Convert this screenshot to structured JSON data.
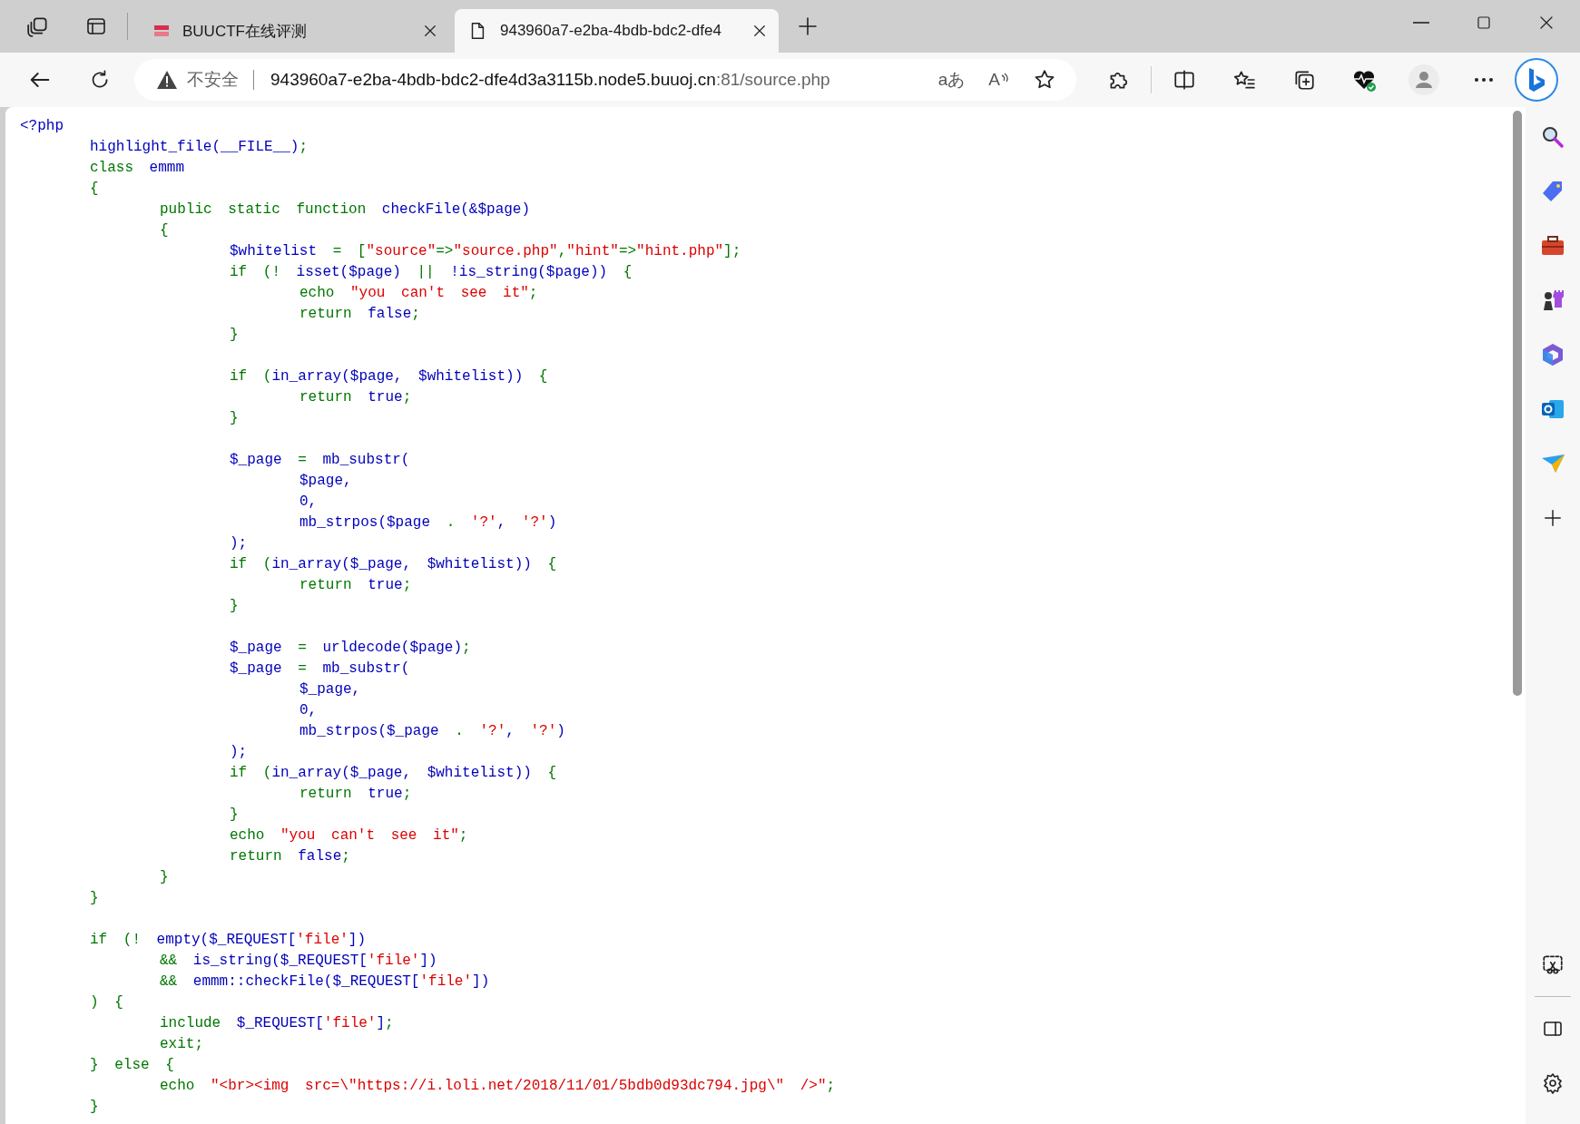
{
  "tabs": [
    {
      "title": "BUUCTF在线评测",
      "selected": false,
      "kind": "site"
    },
    {
      "title": "943960a7-e2ba-4bdb-bdc2-dfe4",
      "selected": true,
      "kind": "page"
    }
  ],
  "address_bar": {
    "security_label": "不安全",
    "url_host": "943960a7-e2ba-4bdb-bdc2-dfe4d3a3115b.node5.buuoj.cn",
    "url_path": ":81/source.php",
    "translate_glyph": "aあ",
    "read_aloud_glyph": "A"
  },
  "code": {
    "lines": [
      {
        "tokens": [
          {
            "kind": "id",
            "text": "<?php"
          }
        ]
      },
      {
        "tokens": [
          {
            "kind": "id",
            "text": "\thighlight_file(__FILE__)"
          },
          {
            "kind": "kw",
            "text": ";"
          }
        ]
      },
      {
        "tokens": [
          {
            "kind": "kw",
            "text": "\tclass "
          },
          {
            "kind": "id",
            "text": "emmm"
          }
        ]
      },
      {
        "tokens": [
          {
            "kind": "kw",
            "text": "\t{"
          }
        ]
      },
      {
        "tokens": [
          {
            "kind": "kw",
            "text": "\t\tpublic static function "
          },
          {
            "kind": "id",
            "text": "checkFile(&$page)"
          }
        ]
      },
      {
        "tokens": [
          {
            "kind": "kw",
            "text": "\t\t{"
          }
        ]
      },
      {
        "tokens": [
          {
            "kind": "id",
            "text": "\t\t\t$whitelist "
          },
          {
            "kind": "kw",
            "text": "= ["
          },
          {
            "kind": "str",
            "text": "\"source\""
          },
          {
            "kind": "kw",
            "text": "=>"
          },
          {
            "kind": "str",
            "text": "\"source.php\""
          },
          {
            "kind": "kw",
            "text": ","
          },
          {
            "kind": "str",
            "text": "\"hint\""
          },
          {
            "kind": "kw",
            "text": "=>"
          },
          {
            "kind": "str",
            "text": "\"hint.php\""
          },
          {
            "kind": "kw",
            "text": "];"
          }
        ]
      },
      {
        "tokens": [
          {
            "kind": "kw",
            "text": "\t\t\tif (! "
          },
          {
            "kind": "id",
            "text": "isset($page) "
          },
          {
            "kind": "kw",
            "text": "|| "
          },
          {
            "kind": "id",
            "text": "!is_string($page)) "
          },
          {
            "kind": "kw",
            "text": "{"
          }
        ]
      },
      {
        "tokens": [
          {
            "kind": "kw",
            "text": "\t\t\t\techo "
          },
          {
            "kind": "str",
            "text": "\"you can't see it\""
          },
          {
            "kind": "kw",
            "text": ";"
          }
        ]
      },
      {
        "tokens": [
          {
            "kind": "kw",
            "text": "\t\t\t\treturn "
          },
          {
            "kind": "id",
            "text": "false"
          },
          {
            "kind": "kw",
            "text": ";"
          }
        ]
      },
      {
        "tokens": [
          {
            "kind": "kw",
            "text": "\t\t\t}"
          }
        ]
      },
      {
        "blank_before": true,
        "tokens": [
          {
            "kind": "kw",
            "text": "\t\t\tif ("
          },
          {
            "kind": "id",
            "text": "in_array($page, $whitelist)) "
          },
          {
            "kind": "kw",
            "text": "{"
          }
        ]
      },
      {
        "tokens": [
          {
            "kind": "kw",
            "text": "\t\t\t\treturn "
          },
          {
            "kind": "id",
            "text": "true"
          },
          {
            "kind": "kw",
            "text": ";"
          }
        ]
      },
      {
        "tokens": [
          {
            "kind": "kw",
            "text": "\t\t\t}"
          }
        ]
      },
      {
        "blank_before": true,
        "tokens": [
          {
            "kind": "id",
            "text": "\t\t\t$_page "
          },
          {
            "kind": "kw",
            "text": "= "
          },
          {
            "kind": "id",
            "text": "mb_substr("
          }
        ]
      },
      {
        "tokens": [
          {
            "kind": "id",
            "text": "\t\t\t\t$page,"
          }
        ]
      },
      {
        "tokens": [
          {
            "kind": "id",
            "text": "\t\t\t\t0,"
          }
        ]
      },
      {
        "tokens": [
          {
            "kind": "id",
            "text": "\t\t\t\tmb_strpos($page "
          },
          {
            "kind": "kw",
            "text": ". "
          },
          {
            "kind": "str",
            "text": "'?'"
          },
          {
            "kind": "id",
            "text": ", "
          },
          {
            "kind": "str",
            "text": "'?'"
          },
          {
            "kind": "id",
            "text": ")"
          }
        ]
      },
      {
        "tokens": [
          {
            "kind": "id",
            "text": "\t\t\t);"
          }
        ]
      },
      {
        "tokens": [
          {
            "kind": "kw",
            "text": "\t\t\tif ("
          },
          {
            "kind": "id",
            "text": "in_array($_page, $whitelist)) "
          },
          {
            "kind": "kw",
            "text": "{"
          }
        ]
      },
      {
        "tokens": [
          {
            "kind": "kw",
            "text": "\t\t\t\treturn "
          },
          {
            "kind": "id",
            "text": "true"
          },
          {
            "kind": "kw",
            "text": ";"
          }
        ]
      },
      {
        "tokens": [
          {
            "kind": "kw",
            "text": "\t\t\t}"
          }
        ]
      },
      {
        "blank_before": true,
        "tokens": [
          {
            "kind": "id",
            "text": "\t\t\t$_page "
          },
          {
            "kind": "kw",
            "text": "= "
          },
          {
            "kind": "id",
            "text": "urldecode($page)"
          },
          {
            "kind": "kw",
            "text": ";"
          }
        ]
      },
      {
        "tokens": [
          {
            "kind": "id",
            "text": "\t\t\t$_page "
          },
          {
            "kind": "kw",
            "text": "= "
          },
          {
            "kind": "id",
            "text": "mb_substr("
          }
        ]
      },
      {
        "tokens": [
          {
            "kind": "id",
            "text": "\t\t\t\t$_page,"
          }
        ]
      },
      {
        "tokens": [
          {
            "kind": "id",
            "text": "\t\t\t\t0,"
          }
        ]
      },
      {
        "tokens": [
          {
            "kind": "id",
            "text": "\t\t\t\tmb_strpos($_page "
          },
          {
            "kind": "kw",
            "text": ". "
          },
          {
            "kind": "str",
            "text": "'?'"
          },
          {
            "kind": "id",
            "text": ", "
          },
          {
            "kind": "str",
            "text": "'?'"
          },
          {
            "kind": "id",
            "text": ")"
          }
        ]
      },
      {
        "tokens": [
          {
            "kind": "id",
            "text": "\t\t\t);"
          }
        ]
      },
      {
        "tokens": [
          {
            "kind": "kw",
            "text": "\t\t\tif ("
          },
          {
            "kind": "id",
            "text": "in_array($_page, $whitelist)) "
          },
          {
            "kind": "kw",
            "text": "{"
          }
        ]
      },
      {
        "tokens": [
          {
            "kind": "kw",
            "text": "\t\t\t\treturn "
          },
          {
            "kind": "id",
            "text": "true"
          },
          {
            "kind": "kw",
            "text": ";"
          }
        ]
      },
      {
        "tokens": [
          {
            "kind": "kw",
            "text": "\t\t\t}"
          }
        ]
      },
      {
        "tokens": [
          {
            "kind": "kw",
            "text": "\t\t\techo "
          },
          {
            "kind": "str",
            "text": "\"you can't see it\""
          },
          {
            "kind": "kw",
            "text": ";"
          }
        ]
      },
      {
        "tokens": [
          {
            "kind": "kw",
            "text": "\t\t\treturn "
          },
          {
            "kind": "id",
            "text": "false"
          },
          {
            "kind": "kw",
            "text": ";"
          }
        ]
      },
      {
        "tokens": [
          {
            "kind": "kw",
            "text": "\t\t}"
          }
        ]
      },
      {
        "tokens": [
          {
            "kind": "kw",
            "text": "\t}"
          }
        ]
      },
      {
        "blank_before": true,
        "tokens": [
          {
            "kind": "kw",
            "text": "\tif (! "
          },
          {
            "kind": "id",
            "text": "empty($_REQUEST["
          },
          {
            "kind": "str",
            "text": "'file'"
          },
          {
            "kind": "id",
            "text": "])"
          }
        ]
      },
      {
        "tokens": [
          {
            "kind": "kw",
            "text": "\t\t&& "
          },
          {
            "kind": "id",
            "text": "is_string($_REQUEST["
          },
          {
            "kind": "str",
            "text": "'file'"
          },
          {
            "kind": "id",
            "text": "])"
          }
        ]
      },
      {
        "tokens": [
          {
            "kind": "kw",
            "text": "\t\t&& "
          },
          {
            "kind": "id",
            "text": "emmm::checkFile($_REQUEST["
          },
          {
            "kind": "str",
            "text": "'file'"
          },
          {
            "kind": "id",
            "text": "])"
          }
        ]
      },
      {
        "tokens": [
          {
            "kind": "kw",
            "text": "\t) {"
          }
        ]
      },
      {
        "tokens": [
          {
            "kind": "kw",
            "text": "\t\tinclude "
          },
          {
            "kind": "id",
            "text": "$_REQUEST["
          },
          {
            "kind": "str",
            "text": "'file'"
          },
          {
            "kind": "id",
            "text": "]"
          },
          {
            "kind": "kw",
            "text": ";"
          }
        ]
      },
      {
        "tokens": [
          {
            "kind": "kw",
            "text": "\t\texit;"
          }
        ]
      },
      {
        "tokens": [
          {
            "kind": "kw",
            "text": "\t} else {"
          }
        ]
      },
      {
        "tokens": [
          {
            "kind": "kw",
            "text": "\t\techo "
          },
          {
            "kind": "str",
            "text": "\"<br><img src=\\\"https://i.loli.net/2018/11/01/5bdb0d93dc794.jpg\\\" />\""
          },
          {
            "kind": "kw",
            "text": ";"
          }
        ]
      },
      {
        "tokens": [
          {
            "kind": "kw",
            "text": "\t}"
          }
        ]
      }
    ]
  }
}
